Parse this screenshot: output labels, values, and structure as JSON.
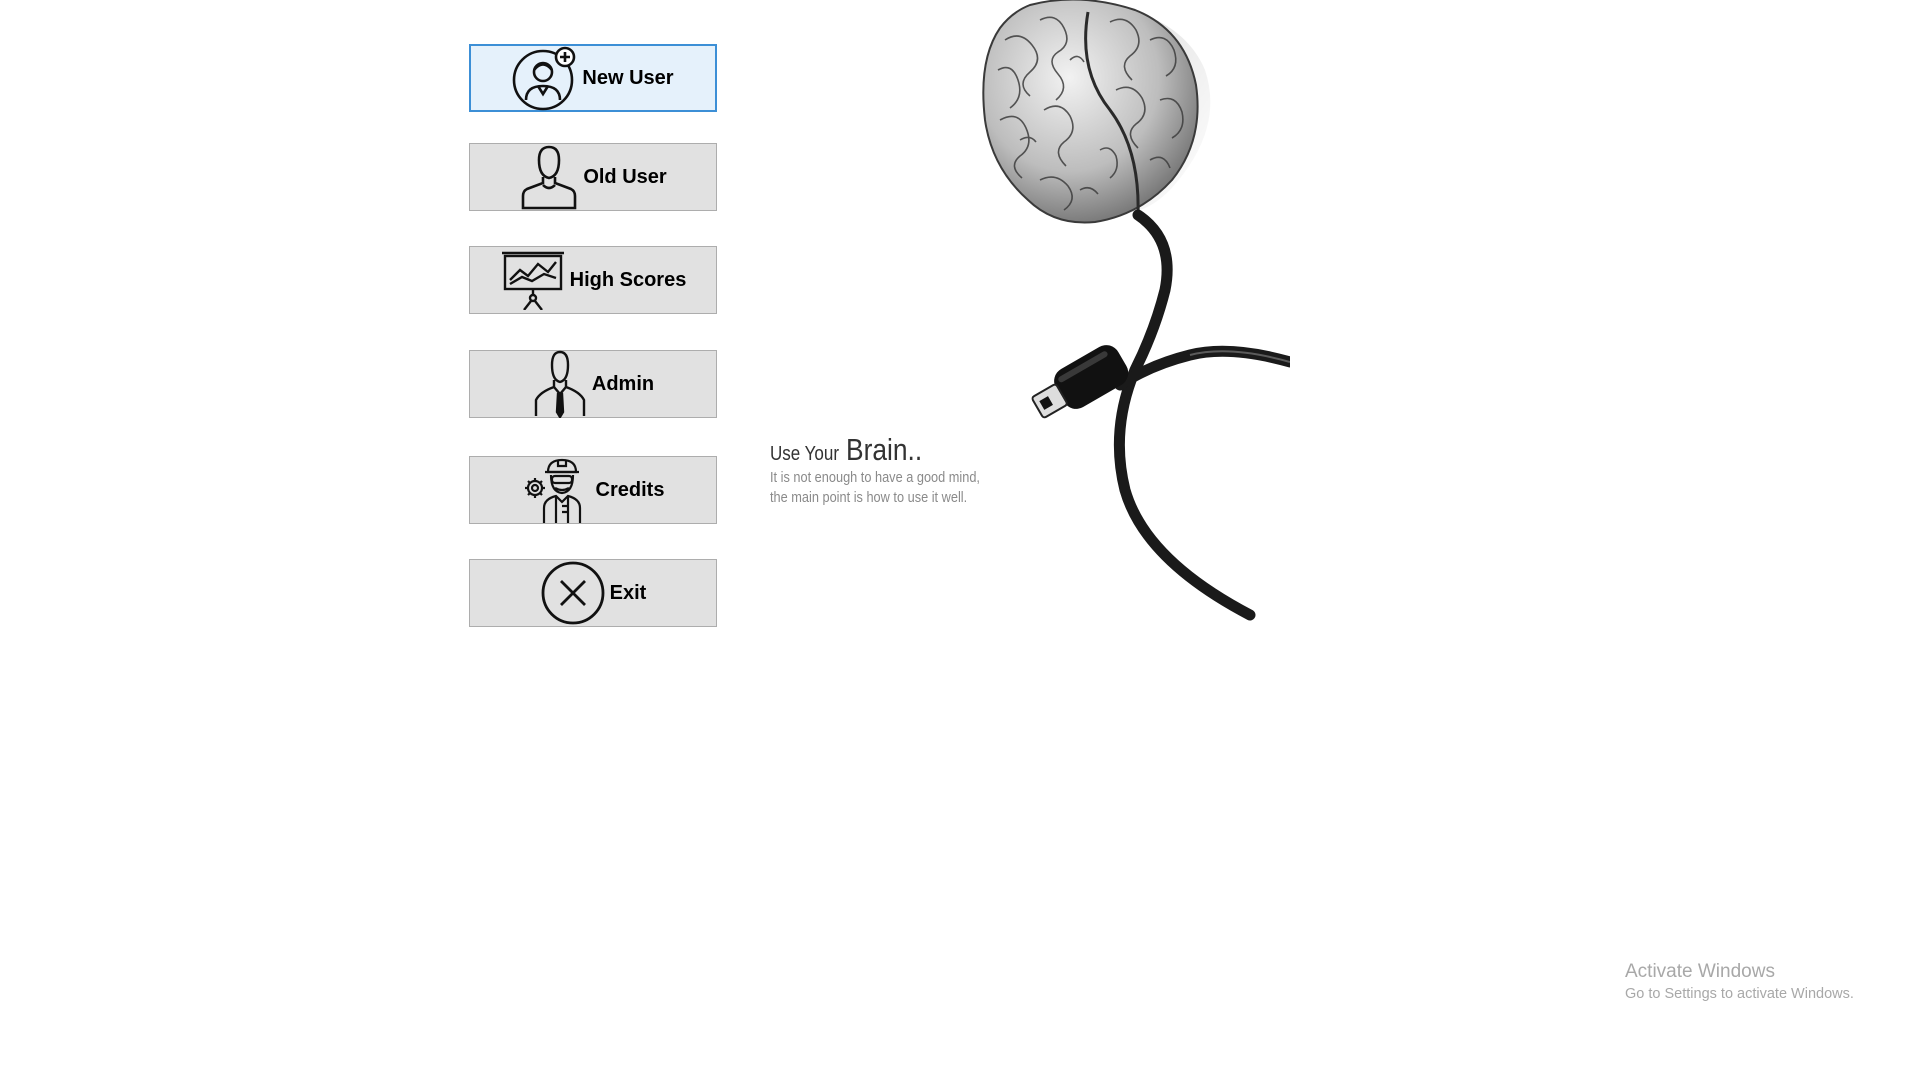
{
  "menu": {
    "new_user": "New User",
    "old_user": "Old User",
    "high_scores": "High Scores",
    "admin": "Admin",
    "credits": "Credits",
    "exit": "Exit"
  },
  "tagline": {
    "prefix": "Use Your",
    "emphasis": "Brain..",
    "line1": "It is not enough to have a good mind,",
    "line2": "the main point is how to use it well."
  },
  "watermark": {
    "title": "Activate Windows",
    "subtitle": "Go to Settings to activate Windows."
  },
  "icons": {
    "new_user": "add-user-icon",
    "old_user": "user-icon",
    "high_scores": "presentation-board-icon",
    "admin": "businessman-icon",
    "credits": "engineer-icon",
    "exit": "close-circle-icon"
  },
  "colors": {
    "button_bg": "#e1e1e1",
    "button_border": "#adadad",
    "selected_bg": "#e5f1fb",
    "selected_border": "#3c8fd6"
  }
}
